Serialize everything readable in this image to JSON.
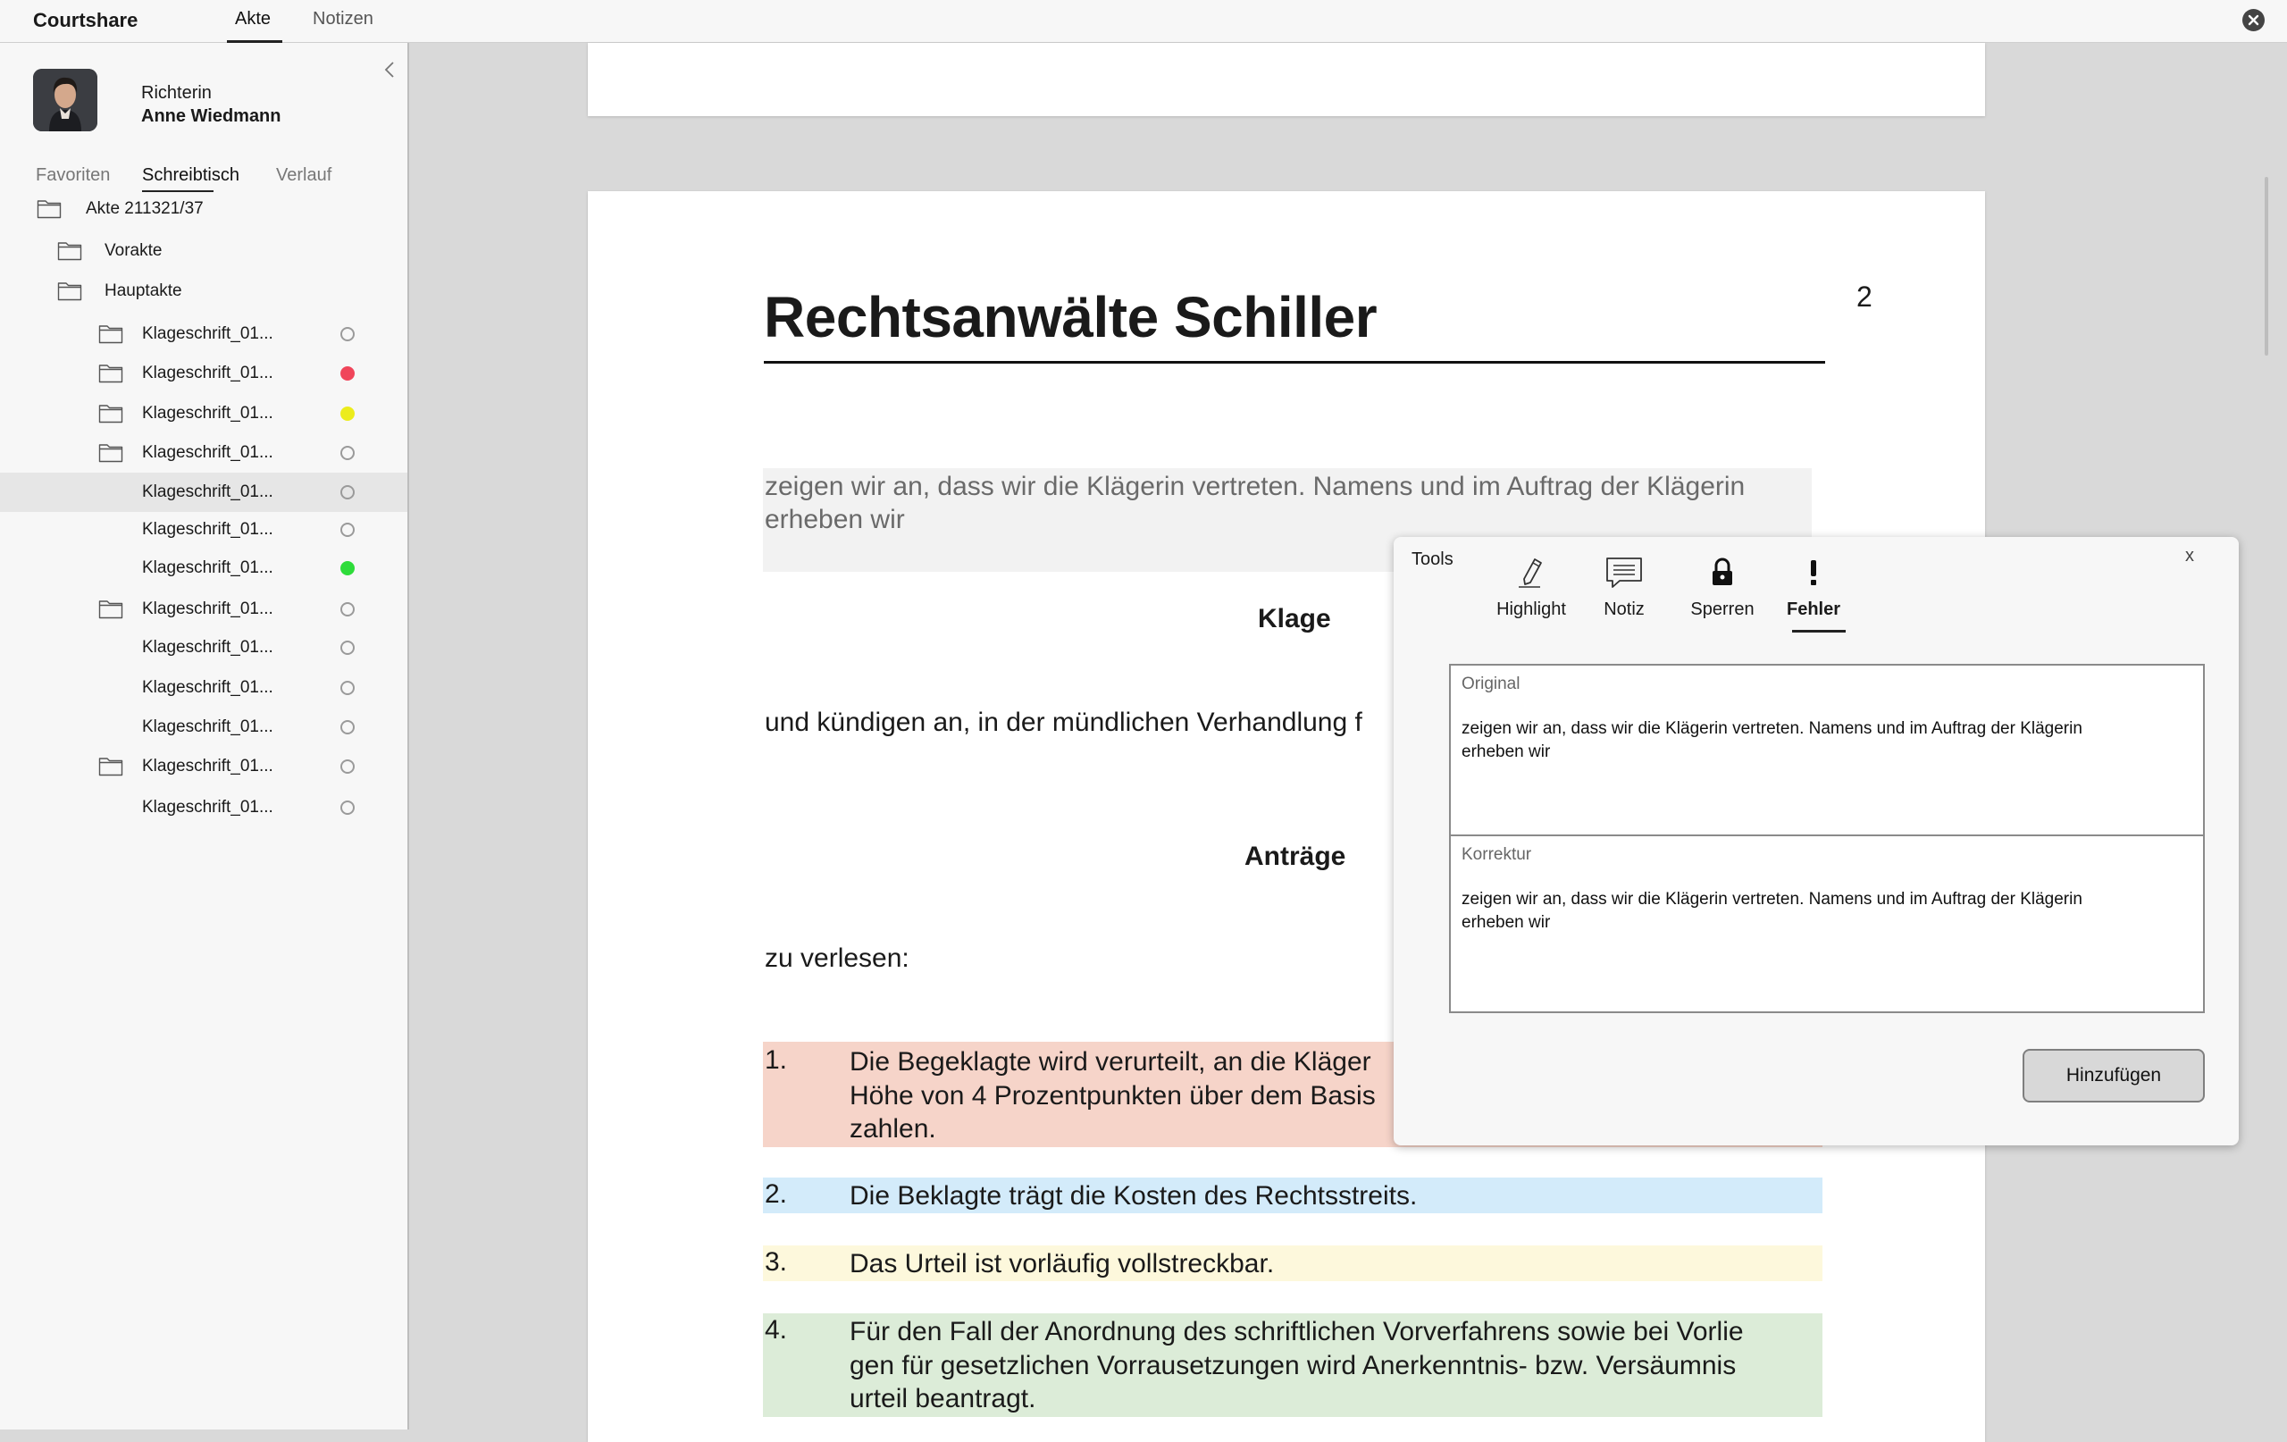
{
  "app": {
    "title": "Courtshare",
    "tabs": [
      "Akte",
      "Notizen"
    ],
    "active_tab": "Akte"
  },
  "user": {
    "role": "Richterin",
    "name": "Anne Wiedmann"
  },
  "sidebar": {
    "tabs": [
      "Favoriten",
      "Schreibtisch",
      "Verlauf"
    ],
    "active_tab": "Schreibtisch",
    "tree": [
      {
        "label": "Akte 211321/37",
        "folder": true,
        "status": null
      },
      {
        "label": "Vorakte",
        "folder": true,
        "status": null
      },
      {
        "label": "Hauptakte",
        "folder": true,
        "status": null
      },
      {
        "label": "Klageschrift_01...",
        "folder": true,
        "status": "empty"
      },
      {
        "label": "Klageschrift_01...",
        "folder": true,
        "status": "red"
      },
      {
        "label": "Klageschrift_01...",
        "folder": true,
        "status": "yellow"
      },
      {
        "label": "Klageschrift_01...",
        "folder": true,
        "status": "empty"
      },
      {
        "label": "Klageschrift_01...",
        "folder": false,
        "status": "empty",
        "selected": true
      },
      {
        "label": "Klageschrift_01...",
        "folder": false,
        "status": "empty"
      },
      {
        "label": "Klageschrift_01...",
        "folder": false,
        "status": "green"
      },
      {
        "label": "Klageschrift_01...",
        "folder": true,
        "status": "empty"
      },
      {
        "label": "Klageschrift_01...",
        "folder": false,
        "status": "empty"
      },
      {
        "label": "Klageschrift_01...",
        "folder": false,
        "status": "empty"
      },
      {
        "label": "Klageschrift_01...",
        "folder": false,
        "status": "empty"
      },
      {
        "label": "Klageschrift_01...",
        "folder": true,
        "status": "empty"
      },
      {
        "label": "Klageschrift_01...",
        "folder": false,
        "status": "empty"
      }
    ]
  },
  "document": {
    "title": "Rechtsanwälte Schiller",
    "page_number": "2",
    "intro": "zeigen wir an, dass wir die Klägerin vertreten. Namens und im Auftrag der Klägerin erheben wir",
    "heading_klage": "Klage",
    "para_kuendigen": "und kündigen an, in der mündlichen Verhandlung f",
    "heading_antraege": "Anträge",
    "para_verlesen": "zu verlesen:",
    "items": [
      {
        "num": "1.",
        "text": "Die Begeklagte wird verurteilt, an die Kläger\nHöhe von 4 Prozentpunkten über dem Basis\nzahlen.",
        "color": "#f6d4c9"
      },
      {
        "num": "2.",
        "text": "Die Beklagte trägt die Kosten des Rechtsstreits.",
        "color": "#d3ebfa"
      },
      {
        "num": "3.",
        "text": "Das Urteil ist vorläufig vollstreckbar.",
        "color": "#fdf8dc"
      },
      {
        "num": "4.",
        "text": "Für den Fall der Anordnung des schriftlichen Vorverfahrens sowie bei Vorlie\ngen  für gesetzlichen Vorrausetzungen wird Anerkenntnis- bzw. Versäumnis\nurteil beantragt.",
        "color": "#dcecd8"
      }
    ]
  },
  "tools": {
    "title": "Tools",
    "close_label": "x",
    "items": [
      {
        "label": "Highlight",
        "icon": "pencil-icon"
      },
      {
        "label": "Notiz",
        "icon": "comment-icon"
      },
      {
        "label": "Sperren",
        "icon": "lock-icon"
      },
      {
        "label": "Fehler",
        "icon": "exclamation-icon"
      }
    ],
    "active_tool": "Fehler",
    "original": {
      "label": "Original",
      "text": "zeigen wir an, dass wir die Klägerin vertreten. Namens und im Auftrag der Klägerin erheben wir"
    },
    "korrektur": {
      "label": "Korrektur",
      "text": "zeigen wir an, dass wir die Klägerin vertreten. Namens und im Auftrag der Klägerin erheben wir"
    },
    "add_button": "Hinzufügen"
  },
  "colors": {
    "status_red": "#f0455a",
    "status_yellow": "#ecec1c",
    "status_green": "#2edc3a"
  }
}
